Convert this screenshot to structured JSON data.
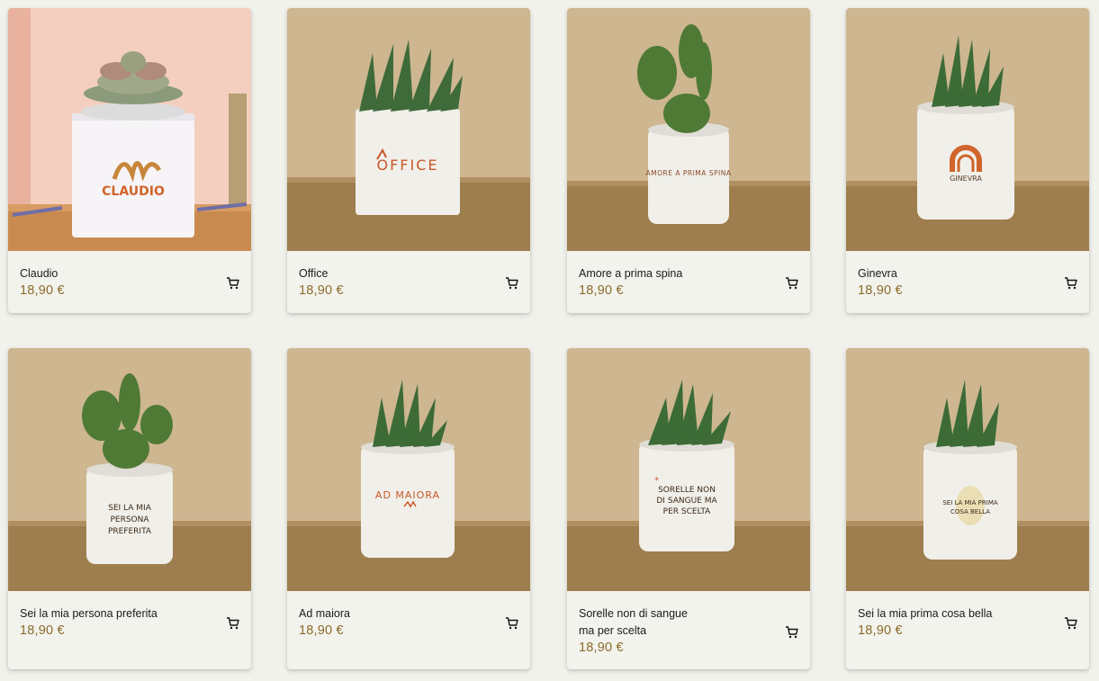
{
  "products": [
    {
      "name": "Claudio",
      "price": "18,90 €",
      "pot_text": "CLAUDIO",
      "plant": "echeveria-succulent",
      "pot_shape": "square",
      "backdrop": "pink-wall"
    },
    {
      "name": "Office",
      "price": "18,90 €",
      "pot_text": "OFFICE",
      "plant": "haworthia-cluster",
      "pot_shape": "square",
      "backdrop": "tan-wall-burlap"
    },
    {
      "name": "Amore a prima spina",
      "price": "18,90 €",
      "pot_text": "AMORE A PRIMA SPINA",
      "plant": "opuntia-cactus",
      "pot_shape": "round",
      "backdrop": "tan-wall-burlap"
    },
    {
      "name": "Ginevra",
      "price": "18,90 €",
      "pot_text": "GINEVRA",
      "plant": "haworthia-single",
      "pot_shape": "round",
      "backdrop": "tan-wall-burlap"
    },
    {
      "name": "Sei la mia persona preferita",
      "price": "18,90 €",
      "pot_text": "SEI LA MIA PERSONA PREFERITA",
      "plant": "opuntia-cactus",
      "pot_shape": "round",
      "backdrop": "tan-wall-burlap"
    },
    {
      "name": "Ad maiora",
      "price": "18,90 €",
      "pot_text": "AD MAIORA",
      "plant": "haworthia-single",
      "pot_shape": "round",
      "backdrop": "tan-wall-burlap"
    },
    {
      "name": "Sorelle non di sangue ma per scelta",
      "price": "18,90 €",
      "pot_text": "SORELLE NON DI SANGUE MA PER SCELTA",
      "plant": "haworthia-single",
      "pot_shape": "round",
      "backdrop": "tan-wall-burlap"
    },
    {
      "name": "Sei la mia prima cosa bella",
      "price": "18,90 €",
      "pot_text": "SEI LA MIA PRIMA COSA BELLA",
      "plant": "haworthia-single",
      "pot_shape": "round",
      "backdrop": "tan-wall-burlap"
    }
  ],
  "icons": {
    "cart": "shopping-cart-icon"
  },
  "colors": {
    "price": "#8a6a2a",
    "background": "#f2f2ec",
    "accent_orange": "#d0642c"
  }
}
